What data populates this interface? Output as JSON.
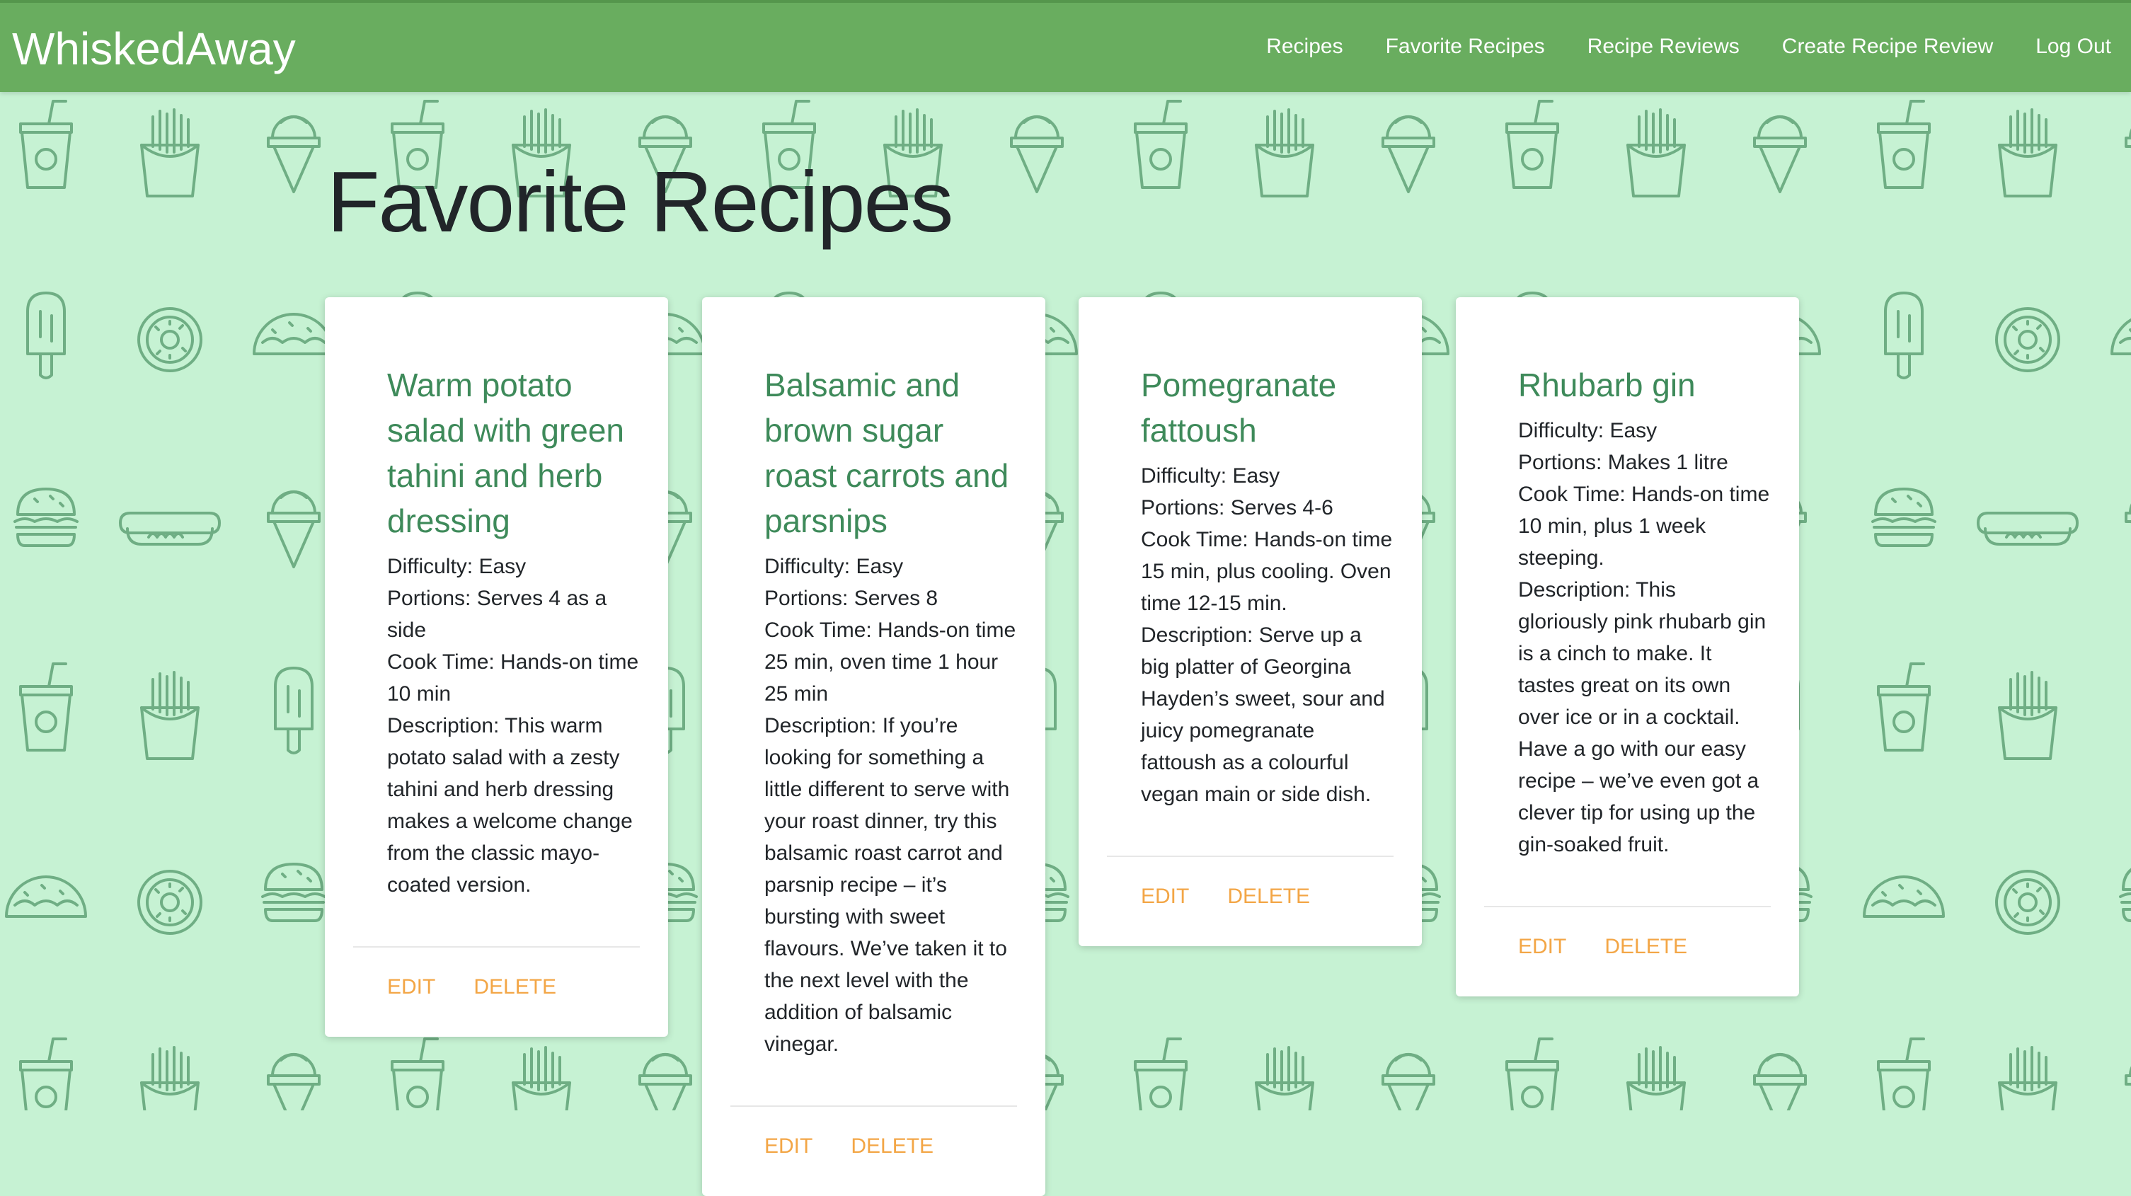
{
  "navbar": {
    "brand": "WhiskedAway",
    "links": [
      "Recipes",
      "Favorite Recipes",
      "Recipe Reviews",
      "Create Recipe Review",
      "Log Out"
    ]
  },
  "page": {
    "title": "Favorite Recipes"
  },
  "cards": [
    {
      "title": "Warm potato salad with green tahini and herb dressing",
      "difficulty": "Difficulty: Easy",
      "portions": "Portions: Serves 4 as a side",
      "cook_time": "Cook Time: Hands-on time 10 min",
      "description": "Description: This warm potato salad with a zesty tahini and herb dressing makes a welcome change from the classic mayo-coated version.",
      "edit_label": "EDIT",
      "delete_label": "DELETE"
    },
    {
      "title": "Balsamic and brown sugar roast carrots and parsnips",
      "difficulty": "Difficulty: Easy",
      "portions": "Portions: Serves 8",
      "cook_time": "Cook Time: Hands-on time 25 min, oven time 1 hour 25 min",
      "description": "Description: If you’re looking for something a little different to serve with your roast dinner, try this balsamic roast carrot and parsnip recipe – it’s bursting with sweet flavours. We’ve taken it to the next level with the addition of balsamic vinegar.",
      "edit_label": "EDIT",
      "delete_label": "DELETE"
    },
    {
      "title": "Pomegranate fattoush",
      "difficulty": "Difficulty: Easy",
      "portions": "Portions: Serves 4-6",
      "cook_time": "Cook Time: Hands-on time 15 min, plus cooling. Oven time 12-15 min.",
      "description": "Description: Serve up a big platter of Georgina Hayden’s sweet, sour and juicy pomegranate fattoush as a colourful vegan main or side dish.",
      "edit_label": "EDIT",
      "delete_label": "DELETE"
    },
    {
      "title": "Rhubarb gin",
      "difficulty": "Difficulty: Easy",
      "portions": "Portions: Makes 1 litre",
      "cook_time": "Cook Time: Hands-on time 10 min, plus 1 week steeping.",
      "description": "Description: This gloriously pink rhubarb gin is a cinch to make. It tastes great on its own over ice or in a cocktail. Have a go with our easy recipe – we’ve even got a clever tip for using up the gin-soaked fruit.",
      "edit_label": "EDIT",
      "delete_label": "DELETE"
    }
  ],
  "colors": {
    "navbar": "#69ad5f",
    "background": "#c6f2d3",
    "pattern_stroke": "#6fae84",
    "card_title": "#3e8a5a",
    "action": "#f3a646"
  },
  "background_icons": [
    "drink-cup-icon",
    "fries-icon",
    "ice-cream-cone-icon",
    "popsicle-icon",
    "donut-icon",
    "taco-icon",
    "burger-icon",
    "hot-dog-icon"
  ]
}
